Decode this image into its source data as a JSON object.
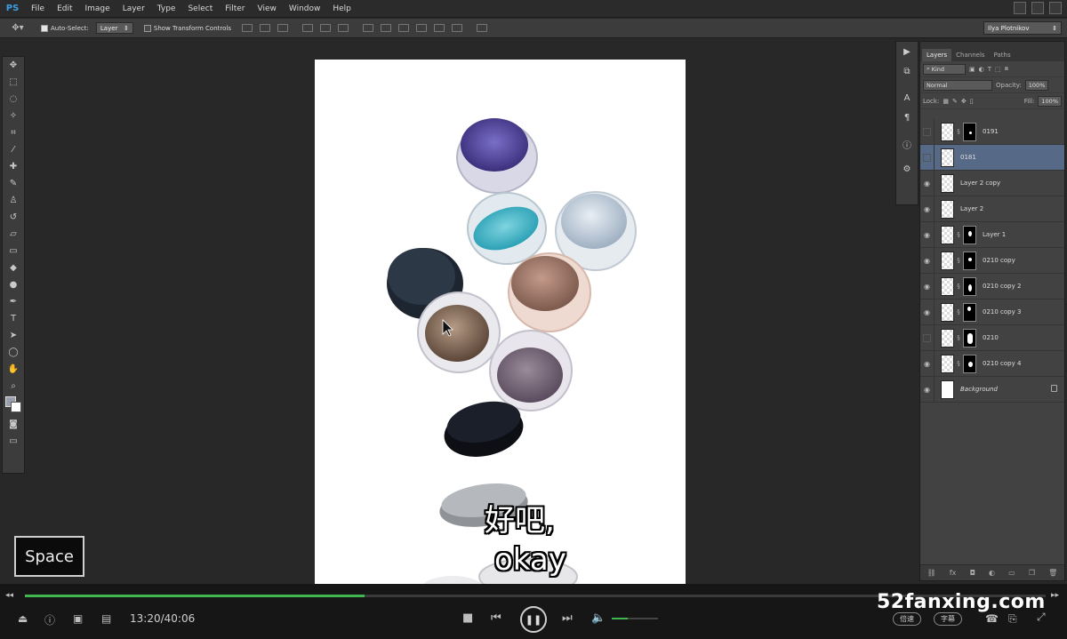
{
  "app": {
    "logo": "PS"
  },
  "menu": [
    "File",
    "Edit",
    "Image",
    "Layer",
    "Type",
    "Select",
    "Filter",
    "View",
    "Window",
    "Help"
  ],
  "options_bar": {
    "auto_select_label": "Auto-Select:",
    "auto_select_target": "Layer",
    "transform_controls_label": "Show Transform Controls",
    "workspace_user": "Ilya Plotnikov"
  },
  "layers_panel": {
    "tabs": [
      "Layers",
      "Channels",
      "Paths"
    ],
    "filter_kind": "Kind",
    "blend_mode": "Normal",
    "opacity_label": "Opacity:",
    "opacity_value": "100%",
    "lock_label": "Lock:",
    "fill_label": "Fill:",
    "fill_value": "100%",
    "layers": [
      {
        "name": "0191",
        "visible": false,
        "mask": true,
        "selected": false
      },
      {
        "name": "0181",
        "visible": false,
        "mask": false,
        "selected": true
      },
      {
        "name": "Layer 2 copy",
        "visible": true,
        "mask": false,
        "selected": false
      },
      {
        "name": "Layer 2",
        "visible": true,
        "mask": false,
        "selected": false
      },
      {
        "name": "Layer 1",
        "visible": true,
        "mask": true,
        "selected": false
      },
      {
        "name": "0210 copy",
        "visible": true,
        "mask": true,
        "selected": false
      },
      {
        "name": "0210 copy 2",
        "visible": true,
        "mask": true,
        "selected": false
      },
      {
        "name": "0210 copy 3",
        "visible": true,
        "mask": true,
        "selected": false
      },
      {
        "name": "0210",
        "visible": false,
        "mask": true,
        "selected": false
      },
      {
        "name": "0210 copy 4",
        "visible": true,
        "mask": true,
        "selected": false
      },
      {
        "name": "Background",
        "visible": true,
        "mask": false,
        "selected": false,
        "locked": true
      }
    ]
  },
  "overlay": {
    "key_badge": "Space",
    "subtitle_cn": "好吧,",
    "subtitle_en": "okay"
  },
  "player": {
    "time": "13:20/40:06",
    "progress": 0.333,
    "volume": 0.35,
    "speed_label": "倍速",
    "subtitle_label": "字幕",
    "watermark": "52fanxing.com",
    "accent": "#3fb64f"
  }
}
